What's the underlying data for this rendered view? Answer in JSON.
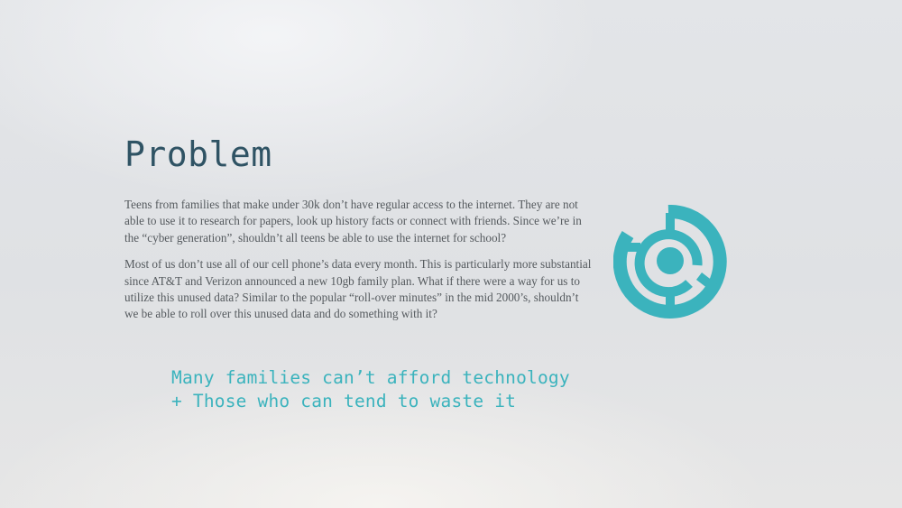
{
  "slide": {
    "title": "Problem",
    "paragraphs": [
      "Teens from families that make under 30k don’t have regular access to the internet. They are not able to use it to research for papers, look up history facts or connect with friends. Since we’re in the “cyber generation”, shouldn’t all teens be able to use the internet for school?",
      "Most of us don’t use all of our cell phone’s data every month. This is particularly more substantial since AT&T and Verizon announced a new 10gb family plan. What if there were a way for us to utilize this unused data? Similar to the popular “roll-over minutes” in the mid 2000’s, shouldn’t we be able to roll over this unused data and do something with it?"
    ],
    "tagline": {
      "line1": "Many families can’t afford technology",
      "line2": "+ Those who can tend to waste it"
    },
    "logo_icon": "concentric-circle-logo-icon",
    "colors": {
      "title": "#2f5364",
      "accent": "#3bb3bd",
      "body_text": "#555a5e"
    }
  }
}
